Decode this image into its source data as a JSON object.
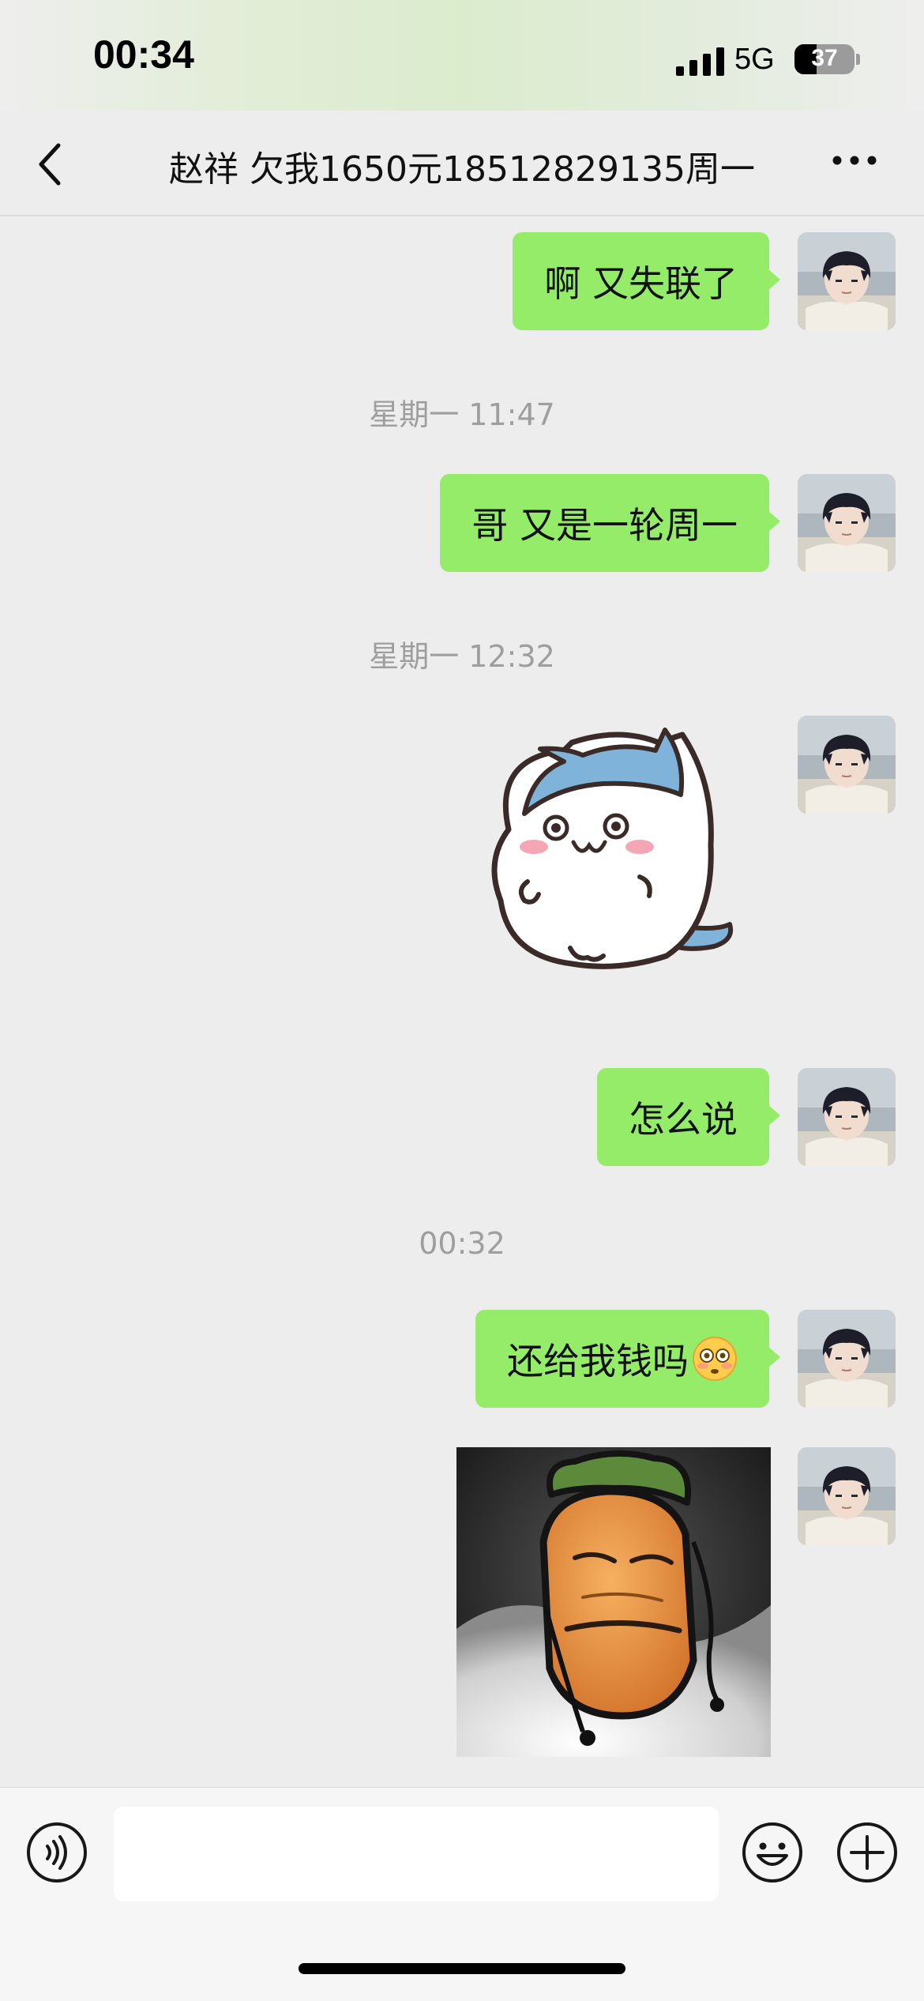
{
  "status_bar": {
    "time": "00:34",
    "network": "5G",
    "battery_level": "37",
    "battery_fraction": 0.37,
    "icons": [
      "signal-icon",
      "battery-icon"
    ]
  },
  "header": {
    "title": "赵祥 欠我1650元18512829135周一",
    "icons": [
      "back-arrow-icon",
      "more-dots-icon"
    ]
  },
  "messages": [
    {
      "type": "text",
      "from": "me",
      "text": "啊 又失联了"
    },
    {
      "type": "timestamp",
      "text": "星期一 11:47"
    },
    {
      "type": "text",
      "from": "me",
      "text": "哥 又是一轮周一"
    },
    {
      "type": "timestamp",
      "text": "星期一 12:32"
    },
    {
      "type": "sticker",
      "from": "me",
      "sticker": "cat-sticker"
    },
    {
      "type": "text",
      "from": "me",
      "text": "怎么说"
    },
    {
      "type": "timestamp",
      "text": "00:32"
    },
    {
      "type": "text",
      "from": "me",
      "text": "还给我钱吗",
      "emoji": "flushed-face-icon"
    },
    {
      "type": "sticker",
      "from": "me",
      "sticker": "carrot-meme-sticker"
    }
  ],
  "input_bar": {
    "placeholder": "",
    "icons": [
      "voice-icon",
      "emoji-icon",
      "add-icon"
    ]
  },
  "colors": {
    "bubble_green": "#95ec69",
    "background": "#ededed",
    "input_bar": "#f6f6f6"
  }
}
